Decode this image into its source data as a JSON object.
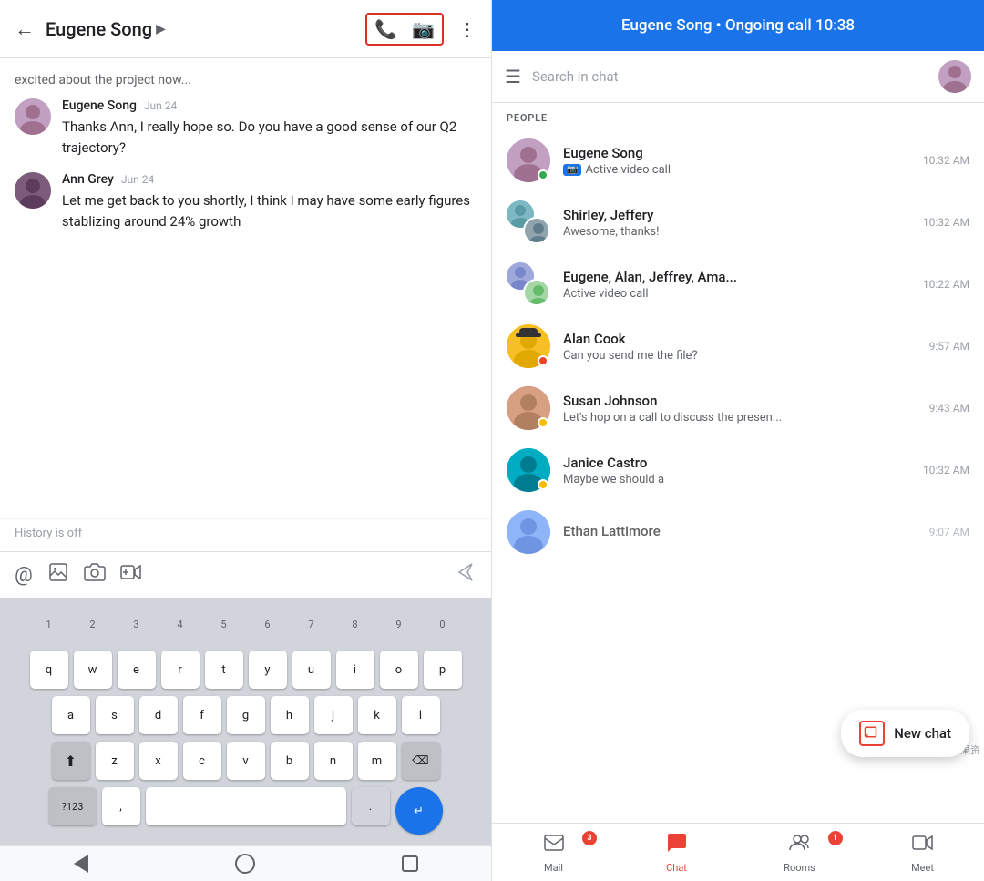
{
  "left": {
    "header": {
      "back_label": "←",
      "title": "Eugene Song",
      "title_arrow": "▶",
      "more_label": "⋮"
    },
    "messages": [
      {
        "id": "preview",
        "text": "excited about the project now..."
      },
      {
        "sender": "Eugene Song",
        "time": "Jun 24",
        "text": "Thanks Ann, I really hope so. Do you have a good sense of our Q2 trajectory?",
        "avatar_type": "eugene"
      },
      {
        "sender": "Ann Grey",
        "time": "Jun 24",
        "text": "Let me get back to you shortly, I think I may have some early figures stablizing around 24% growth",
        "avatar_type": "ann"
      }
    ],
    "history_off": "History is off",
    "toolbar": {
      "at_icon": "@",
      "image_icon": "🖼",
      "camera_icon": "📷",
      "video_icon": "📹",
      "send_icon": "▷"
    },
    "keyboard": {
      "row1": [
        "1",
        "2",
        "3",
        "4",
        "5",
        "6",
        "7",
        "8",
        "9",
        "0"
      ],
      "row2": [
        "q",
        "w",
        "e",
        "r",
        "t",
        "y",
        "u",
        "i",
        "o",
        "p"
      ],
      "row3": [
        "a",
        "s",
        "d",
        "f",
        "g",
        "h",
        "j",
        "k",
        "l"
      ],
      "row4": [
        "z",
        "x",
        "c",
        "v",
        "b",
        "n",
        "m"
      ],
      "special_left": "?123",
      "comma": ",",
      "dot": ".",
      "special_right": "⌫"
    },
    "nav": {
      "back": "◀",
      "home": "○",
      "recent": "□"
    }
  },
  "right": {
    "header": {
      "title": "Eugene Song • Ongoing call 10:38"
    },
    "search": {
      "placeholder": "Search in chat",
      "hamburger": "☰"
    },
    "section_label": "PEOPLE",
    "contacts": [
      {
        "name": "Eugene Song",
        "sub": "Active video call",
        "time": "10:32 AM",
        "avatar_color": "bg-purple",
        "avatar_letter": "E",
        "status": "green",
        "has_video": true,
        "is_group": false
      },
      {
        "name": "Shirley, Jeffery",
        "sub": "Awesome, thanks!",
        "time": "10:32 AM",
        "avatar_color": "bg-teal",
        "avatar_letter": "SJ",
        "status": "",
        "has_video": false,
        "is_group": true
      },
      {
        "name": "Eugene, Alan, Jeffrey, Ama...",
        "sub": "Active video call",
        "time": "10:22 AM",
        "avatar_color": "bg-blue",
        "avatar_letter": "EA",
        "status": "",
        "has_video": false,
        "is_group": true
      },
      {
        "name": "Alan Cook",
        "sub": "Can you send me the file?",
        "time": "9:57 AM",
        "avatar_color": "bg-yellow",
        "avatar_letter": "A",
        "status": "red",
        "has_video": false,
        "is_group": false
      },
      {
        "name": "Susan Johnson",
        "sub": "Let's hop on a call to discuss the presen...",
        "time": "9:43 AM",
        "avatar_color": "bg-pink",
        "avatar_letter": "S",
        "status": "orange",
        "has_video": false,
        "is_group": false
      },
      {
        "name": "Janice Castro",
        "sub": "Maybe we should a",
        "time": "10:32 AM",
        "avatar_color": "bg-teal",
        "avatar_letter": "J",
        "status": "orange",
        "has_video": false,
        "is_group": false
      },
      {
        "name": "Ethan Lattimore",
        "sub": "",
        "time": "9:07 AM",
        "avatar_color": "bg-green",
        "avatar_letter": "E",
        "status": "",
        "has_video": false,
        "is_group": false
      }
    ],
    "new_chat": {
      "label": "New chat",
      "icon": "□"
    },
    "bottom_nav": [
      {
        "id": "mail",
        "label": "Mail",
        "icon": "✉",
        "badge": "3",
        "active": false
      },
      {
        "id": "chat",
        "label": "Chat",
        "icon": "💬",
        "badge": "",
        "active": true
      },
      {
        "id": "rooms",
        "label": "Rooms",
        "icon": "👥",
        "badge": "1",
        "active": false
      },
      {
        "id": "meet",
        "label": "Meet",
        "icon": "📹",
        "badge": "",
        "active": false
      }
    ]
  }
}
